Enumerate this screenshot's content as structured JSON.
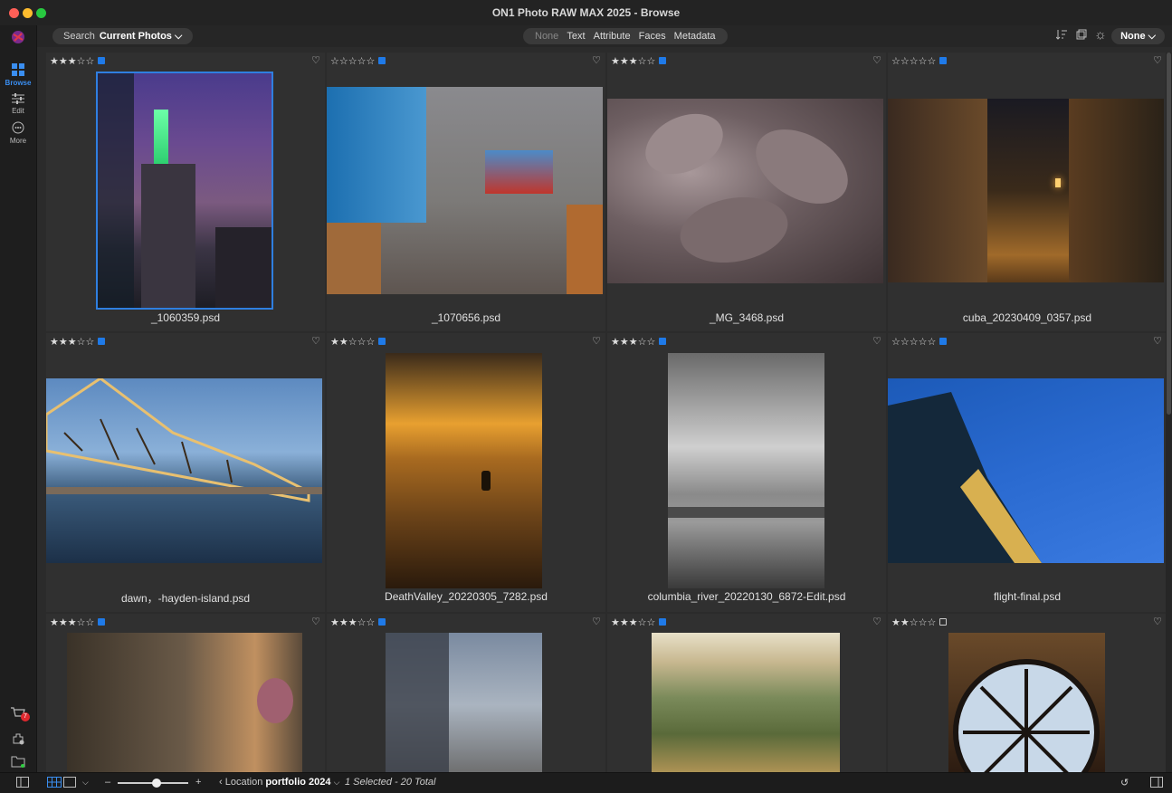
{
  "app": {
    "title": "ON1 Photo RAW MAX 2025 - Browse"
  },
  "sidebar": {
    "browse_label": "Browse",
    "edit_label": "Edit",
    "more_label": "More",
    "cart_badge": "7",
    "icons": [
      "on1-logo-icon",
      "browse-grid-icon",
      "edit-sliders-icon",
      "more-dots-icon",
      "cart-icon",
      "extensions-icon",
      "folder-icon"
    ]
  },
  "toolbar": {
    "search_label": "Search",
    "search_scope": "Current Photos ⌵",
    "filters": [
      "None",
      "Text",
      "Attribute",
      "Faces",
      "Metadata"
    ],
    "active_filter": "None",
    "right_dropdown": "None ⌵"
  },
  "colors": {
    "accent": "#2f7fe0",
    "label_blue": "#1f7ae8",
    "background": "#2b2b2b",
    "cell": "#303030"
  },
  "grid": {
    "cells": [
      {
        "file": "_1060359.psd",
        "stars": "★★★☆☆",
        "label": "blue",
        "selected": true
      },
      {
        "file": "_1070656.psd",
        "stars": "☆☆☆☆☆",
        "label": "blue",
        "selected": false
      },
      {
        "file": "_MG_3468.psd",
        "stars": "★★★☆☆",
        "label": "blue",
        "selected": false
      },
      {
        "file": "cuba_20230409_0357.psd",
        "stars": "☆☆☆☆☆",
        "label": "blue",
        "selected": false
      },
      {
        "file": "dawn，-hayden-island.psd",
        "stars": "★★★☆☆",
        "label": "blue",
        "selected": false
      },
      {
        "file": "DeathValley_20220305_7282.psd",
        "stars": "★★☆☆☆",
        "label": "blue",
        "selected": false
      },
      {
        "file": "columbia_river_20220130_6872-Edit.psd",
        "stars": "★★★☆☆",
        "label": "blue",
        "selected": false
      },
      {
        "file": "flight-final.psd",
        "stars": "☆☆☆☆☆",
        "label": "blue",
        "selected": false
      },
      {
        "file": "",
        "stars": "★★★☆☆",
        "label": "blue",
        "selected": false
      },
      {
        "file": "",
        "stars": "★★★☆☆",
        "label": "blue",
        "selected": false
      },
      {
        "file": "",
        "stars": "★★★☆☆",
        "label": "blue",
        "selected": false
      },
      {
        "file": "",
        "stars": "★★☆☆☆",
        "label": "none",
        "selected": false
      }
    ]
  },
  "statusbar": {
    "location_prefix": "‹ Location",
    "location_name": "portfolio 2024",
    "location_chevron": "⌵",
    "selection": "1 Selected - 20 Total",
    "zoom_minus": "–",
    "zoom_plus": "+",
    "zoom_level": 0.55
  }
}
